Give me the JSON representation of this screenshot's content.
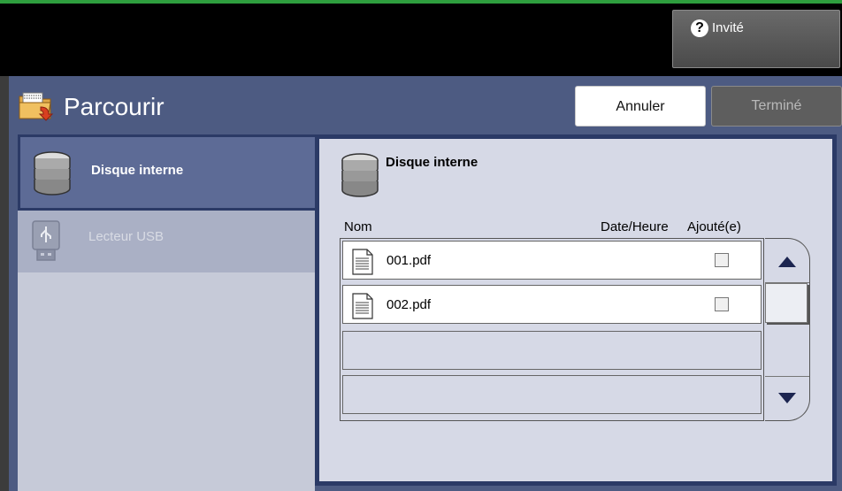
{
  "header": {
    "user_label": "Invité",
    "user_icon": "help-icon"
  },
  "titlebar": {
    "title": "Parcourir",
    "title_icon": "folder-browse-icon",
    "cancel_label": "Annuler",
    "done_label": "Terminé"
  },
  "sources": [
    {
      "label": "Disque interne",
      "icon": "hard-disk-icon",
      "selected": true,
      "enabled": true
    },
    {
      "label": "Lecteur USB",
      "icon": "usb-drive-icon",
      "selected": false,
      "enabled": false
    }
  ],
  "browser": {
    "title": "Disque interne",
    "icon": "hard-disk-icon",
    "columns": {
      "name": "Nom",
      "date": "Date/Heure",
      "added": "Ajouté(e)"
    },
    "files": [
      {
        "name": "001.pdf",
        "icon": "document-icon",
        "added": false
      },
      {
        "name": "002.pdf",
        "icon": "document-icon",
        "added": false
      }
    ]
  },
  "colors": {
    "accent": "#4d5b82",
    "selected": "#5d6b96",
    "panel": "#d6d9e6",
    "status_bar": "#2e9e3e"
  }
}
